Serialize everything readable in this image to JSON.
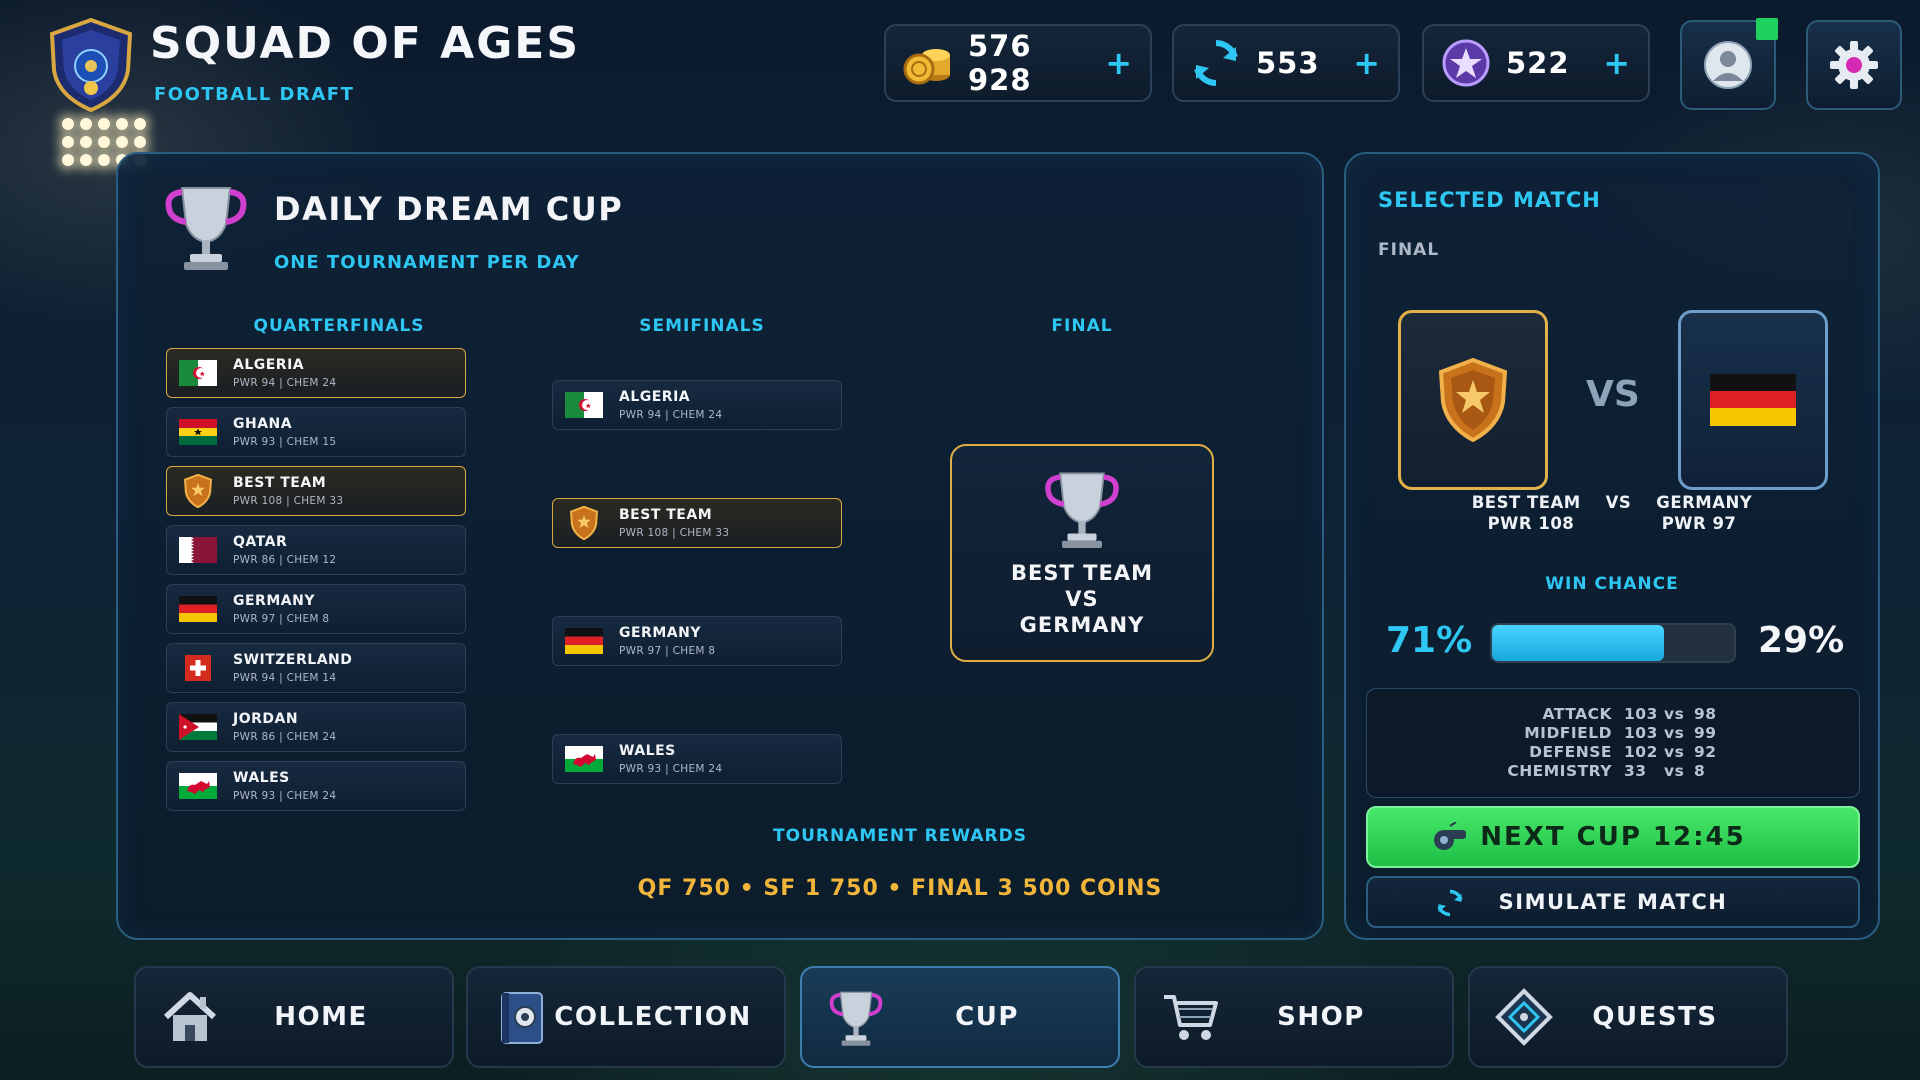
{
  "header": {
    "title": "SQUAD OF AGES",
    "subtitle": "FOOTBALL DRAFT"
  },
  "currencies": [
    {
      "icon": "coins-icon",
      "value": "576 928",
      "plus": "+"
    },
    {
      "icon": "refresh-token-icon",
      "value": "553",
      "plus": "+"
    },
    {
      "icon": "star-gem-icon",
      "value": "522",
      "plus": "+"
    }
  ],
  "tournament": {
    "title": "DAILY DREAM CUP",
    "subtitle": "ONE TOURNAMENT PER DAY",
    "columns": {
      "qf": "QUARTERFINALS",
      "sf": "SEMIFINALS",
      "final": "FINAL"
    },
    "quarterfinals": [
      {
        "name": "ALGERIA",
        "stats": "PWR 94 | CHEM 24",
        "flag": "algeria"
      },
      {
        "name": "GHANA",
        "stats": "PWR 93 | CHEM 15",
        "flag": "ghana"
      },
      {
        "name": "BEST TEAM",
        "stats": "PWR 108 | CHEM 33",
        "flag": "shield"
      },
      {
        "name": "QATAR",
        "stats": "PWR 86 | CHEM 12",
        "flag": "qatar"
      },
      {
        "name": "GERMANY",
        "stats": "PWR 97 | CHEM 8",
        "flag": "germany"
      },
      {
        "name": "SWITZERLAND",
        "stats": "PWR 94 | CHEM 14",
        "flag": "switzerland"
      },
      {
        "name": "JORDAN",
        "stats": "PWR 86 | CHEM 24",
        "flag": "jordan"
      },
      {
        "name": "WALES",
        "stats": "PWR 93 | CHEM 24",
        "flag": "wales"
      }
    ],
    "semifinals": [
      {
        "name": "ALGERIA",
        "stats": "PWR 94 | CHEM 24",
        "flag": "algeria"
      },
      {
        "name": "BEST TEAM",
        "stats": "PWR 108 | CHEM 33",
        "flag": "shield"
      },
      {
        "name": "GERMANY",
        "stats": "PWR 97 | CHEM 8",
        "flag": "germany"
      },
      {
        "name": "WALES",
        "stats": "PWR 93 | CHEM 24",
        "flag": "wales"
      }
    ],
    "final": {
      "team1": "BEST TEAM",
      "vs": "VS",
      "team2": "GERMANY"
    },
    "rewards_title": "TOURNAMENT REWARDS",
    "rewards_line": "QF 750  •  SF 1 750  •  FINAL 3 500 COINS"
  },
  "selected_match": {
    "title": "SELECTED MATCH",
    "stage": "FINAL",
    "vs": "VS",
    "teams_line": "BEST TEAM    VS    GERMANY",
    "pwr_line": "PWR 108              PWR 97",
    "win_chance_label": "WIN CHANCE",
    "win_left": "71%",
    "win_right": "29%",
    "win_fraction": 0.71,
    "stats": [
      {
        "label": "ATTACK",
        "a": "103",
        "vs": "vs",
        "b": "98"
      },
      {
        "label": "MIDFIELD",
        "a": "103",
        "vs": "vs",
        "b": "99"
      },
      {
        "label": "DEFENSE",
        "a": "102",
        "vs": "vs",
        "b": "92"
      },
      {
        "label": "CHEMISTRY",
        "a": "33",
        "vs": "vs",
        "b": "8"
      }
    ],
    "next_cup": "NEXT CUP 12:45",
    "simulate": "SIMULATE MATCH"
  },
  "nav": [
    {
      "label": "HOME",
      "icon": "home-icon",
      "active": false
    },
    {
      "label": "COLLECTION",
      "icon": "collection-book-icon",
      "active": false
    },
    {
      "label": "CUP",
      "icon": "trophy-icon",
      "active": true
    },
    {
      "label": "SHOP",
      "icon": "cart-icon",
      "active": false
    },
    {
      "label": "QUESTS",
      "icon": "quest-diamond-icon",
      "active": false
    }
  ],
  "colors": {
    "accent": "#2ec6f2",
    "gold": "#dcae45",
    "green": "#2fd456",
    "reward": "#f0b53a"
  }
}
